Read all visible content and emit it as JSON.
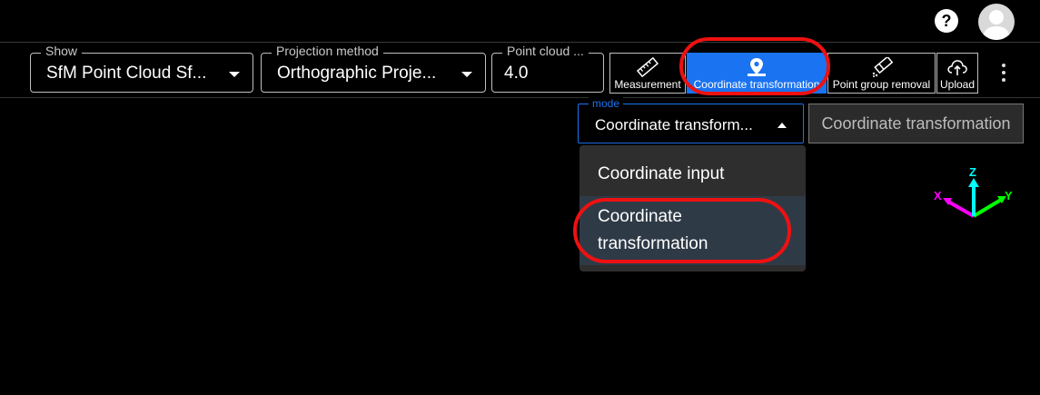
{
  "header": {
    "help_label": "?",
    "icons": {
      "help": "help-icon",
      "avatar": "user-avatar-icon"
    }
  },
  "toolbar": {
    "show": {
      "legend": "Show",
      "value": "SfM Point Cloud Sf..."
    },
    "projection": {
      "legend": "Projection method",
      "value": "Orthographic Proje..."
    },
    "point_cloud": {
      "legend": "Point cloud ...",
      "value": "4.0"
    },
    "tools": [
      {
        "label": "Measurement",
        "icon": "ruler-icon"
      },
      {
        "label": "Coordinate transformation",
        "icon": "map-pin-icon"
      },
      {
        "label": "Point group removal",
        "icon": "eraser-icon"
      },
      {
        "label": "Upload",
        "icon": "cloud-upload-icon"
      }
    ],
    "more_icon": "kebab-menu-icon"
  },
  "mode": {
    "legend": "mode",
    "value": "Coordinate transform...",
    "options": [
      "Coordinate input",
      "Coordinate transformation"
    ],
    "selected": "Coordinate transformation",
    "apply_button": "Coordinate transformation"
  },
  "axes": {
    "x": "X",
    "y": "Y",
    "z": "Z"
  },
  "colors": {
    "accent": "#1a73f0",
    "annotation": "#e11111",
    "axis_x": "#ff00ff",
    "axis_y": "#00ff00",
    "axis_z": "#00ffff"
  }
}
